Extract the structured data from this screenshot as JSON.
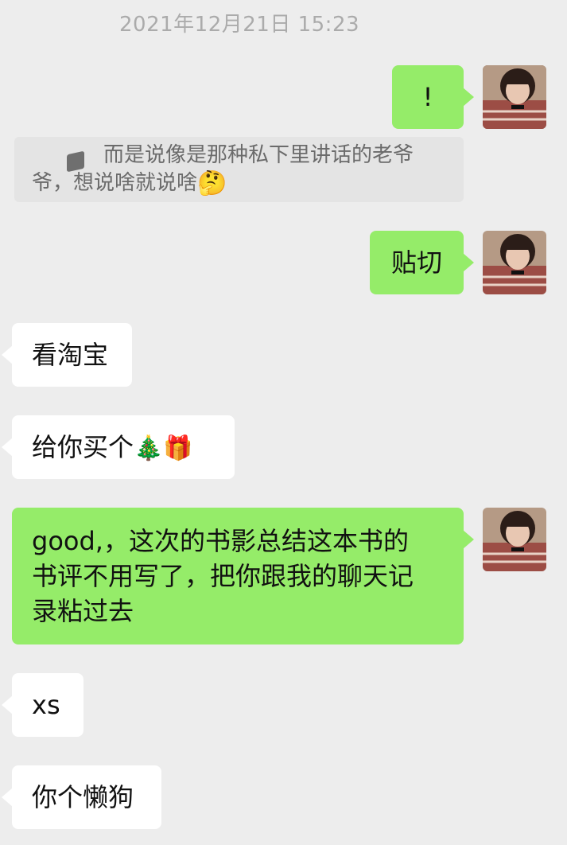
{
  "timestamp": "2021年12月21日 15:23",
  "messages": [
    {
      "text": "!"
    },
    {
      "text": "而是说像是那种私下里讲话的老爷爷，想说啥就说啥",
      "emoji": "🤔"
    },
    {
      "text": "贴切"
    },
    {
      "text": "看淘宝"
    },
    {
      "text": "给你买个",
      "emoji1": "🎄",
      "emoji2": "🎁"
    },
    {
      "line1": "good,，这次的书影总结这本书的",
      "line2": "书评不用写了，把你跟我的聊天记",
      "line3": "录粘过去"
    },
    {
      "text": "xs"
    },
    {
      "text": "你个懒狗"
    }
  ],
  "colors": {
    "background": "#ededed",
    "outgoing_bubble": "#95ec69",
    "incoming_bubble": "#ffffff",
    "quote_background": "#e4e4e4"
  },
  "icons": {
    "avatar": "user-avatar-photo",
    "quote": "quote-icon"
  }
}
